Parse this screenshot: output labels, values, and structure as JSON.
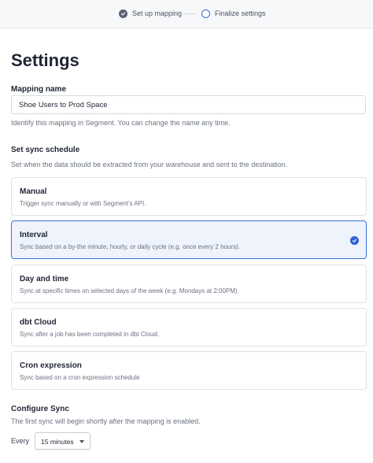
{
  "stepper": {
    "steps": [
      {
        "label": "Set up mapping",
        "state": "done"
      },
      {
        "label": "Finalize settings",
        "state": "current"
      }
    ]
  },
  "page": {
    "title": "Settings"
  },
  "mapping_name": {
    "label": "Mapping name",
    "value": "Shoe Users to Prod Space",
    "help": "Identify this mapping in Segment. You can change the name any time."
  },
  "sync_schedule": {
    "label": "Set sync schedule",
    "help": "Set when the data should be extracted from your warehouse and sent to the destination.",
    "options": [
      {
        "title": "Manual",
        "description": "Trigger sync manually or with Segment's API.",
        "selected": false
      },
      {
        "title": "Interval",
        "description": "Sync based on a by-the minute, hourly, or daily cycle (e.g. once every 2 hours).",
        "selected": true
      },
      {
        "title": "Day and time",
        "description": "Sync at specific times on selected days of the week (e.g. Mondays at 2:00PM).",
        "selected": false
      },
      {
        "title": "dbt Cloud",
        "description": "Sync after a job has been completed in dbt Cloud.",
        "selected": false
      },
      {
        "title": "Cron expression",
        "description": "Sync based on a cron expression schedule",
        "selected": false
      }
    ]
  },
  "configure_sync": {
    "label": "Configure Sync",
    "help": "The first sync will begin shortly after the mapping is enabled.",
    "every_label": "Every",
    "interval_value": "15 minutes"
  },
  "colors": {
    "accent": "#2f62d3",
    "selected_bg": "#eef3fc",
    "text": "#1f2533",
    "muted": "#6b7280"
  },
  "icons": {
    "step_done": "check-circle-icon",
    "step_current": "circle-outline-icon",
    "selected": "check-circle-icon",
    "dropdown": "caret-down-icon"
  }
}
